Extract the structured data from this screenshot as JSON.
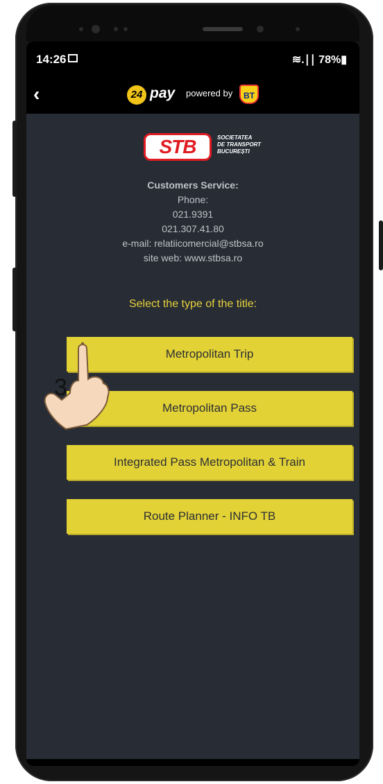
{
  "status": {
    "time": "14:26",
    "right": "≋.∣∣ 78%▮"
  },
  "appbar": {
    "back_icon": "chevron-left-icon",
    "brand_badge": "24",
    "brand_name": "pay",
    "powered_by": "powered by",
    "bank_badge": "BT"
  },
  "company": {
    "logo_mark": "STB",
    "logo_lines": [
      "SOCIETATEA",
      "DE TRANSPORT",
      "BUCUREȘTI"
    ],
    "heading": "Customers Service:",
    "phone_label": "Phone:",
    "phones": [
      "021.9391",
      "021.307.41.80"
    ],
    "email": "e-mail: relatiicomercial@stbsa.ro",
    "site": "site web: www.stbsa.ro"
  },
  "select_title": "Select the type of the title:",
  "buttons": [
    {
      "label": "Metropolitan Trip"
    },
    {
      "label": "Metropolitan Pass"
    },
    {
      "label": "Integrated Pass Metropolitan & Train"
    },
    {
      "label": "Route Planner - INFO TB"
    }
  ],
  "step_marker": "3",
  "colors": {
    "accent": "#e3d236",
    "background": "#272c35",
    "title_yellow": "#e8d23b",
    "stb_red": "#e01b22"
  }
}
